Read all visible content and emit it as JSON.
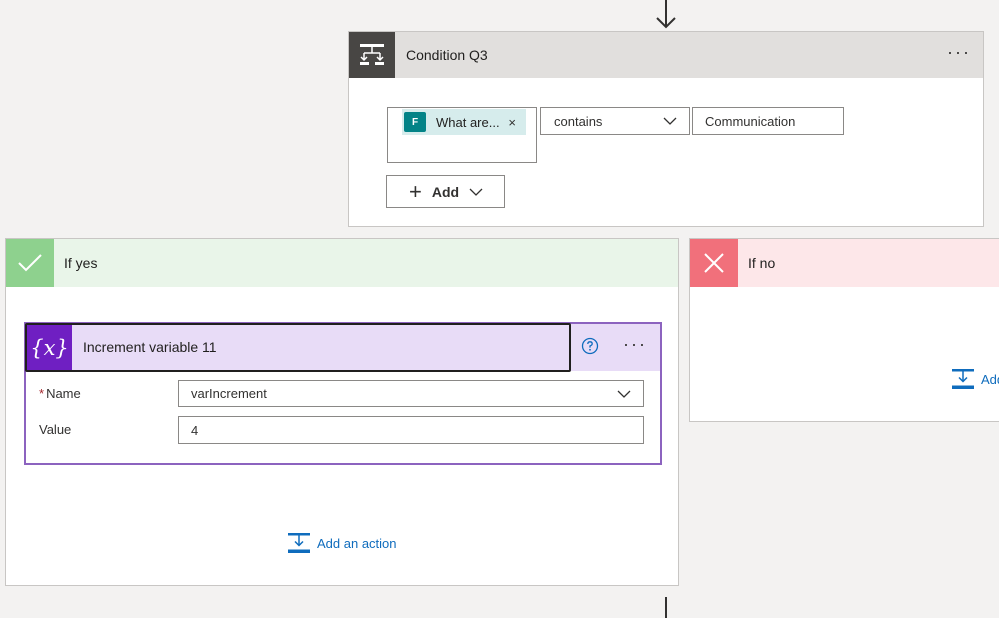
{
  "condition": {
    "title": "Condition Q3",
    "more_label": "···",
    "left_token": {
      "label": "What are...",
      "remove": "×",
      "app_icon": "forms-icon"
    },
    "operator": "contains",
    "right_value": "Communication",
    "add_button": {
      "label": "Add",
      "plus": "+"
    }
  },
  "yes_branch": {
    "title": "If yes",
    "action": {
      "title": "Increment variable 11",
      "icon_text": "{x}",
      "more_label": "···",
      "fields": {
        "name_label": "Name",
        "name_required": "*",
        "name_value": "varIncrement",
        "value_label": "Value",
        "value_value": "4"
      }
    },
    "add_action_label": "Add an action"
  },
  "no_branch": {
    "title": "If no",
    "add_action_label": "Add"
  },
  "colors": {
    "condition_header": "#e1dfdd",
    "yes_accent": "#8ed18e",
    "no_accent": "#f1707b",
    "variable_accent": "#6f1fc2",
    "link": "#0f6cbd"
  }
}
